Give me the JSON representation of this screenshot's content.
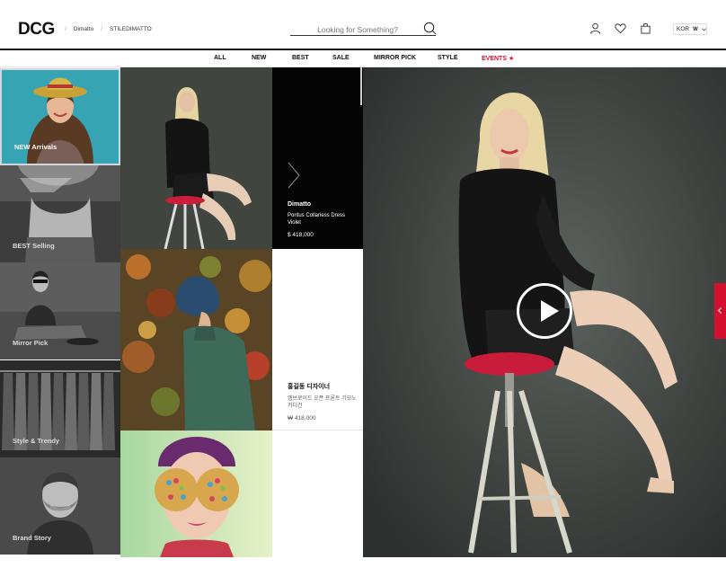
{
  "header": {
    "logo": "DCG",
    "breadcrumbs": [
      "Dimatto",
      "STILEDIMATTO"
    ],
    "search_placeholder": "Looking for Something?",
    "language": "KOR",
    "language_flag": "W"
  },
  "nav": {
    "items": [
      "ALL",
      "NEW",
      "BEST",
      "SALE",
      "MIRROR PICK",
      "STYLE"
    ],
    "events_label": "EVENTS ★",
    "events_color": "#d5102f"
  },
  "categories": [
    {
      "label": "NEW Arrivals"
    },
    {
      "label": "BEST Selling"
    },
    {
      "label": "Mirror Pick"
    },
    {
      "label": "Style & Trendy"
    },
    {
      "label": "Brand Story"
    }
  ],
  "products": [
    {
      "brand": "Dimatto",
      "name": "Poritus Collarless Dress Violet",
      "price": "$ 418,000"
    },
    {
      "brand": "홍길동 디자이너",
      "name": "엠브로이드 오픈 프론트 기모노 카디건",
      "price": "₩ 418,000"
    }
  ],
  "colors": {
    "accent": "#d5102f",
    "text": "#111111"
  }
}
